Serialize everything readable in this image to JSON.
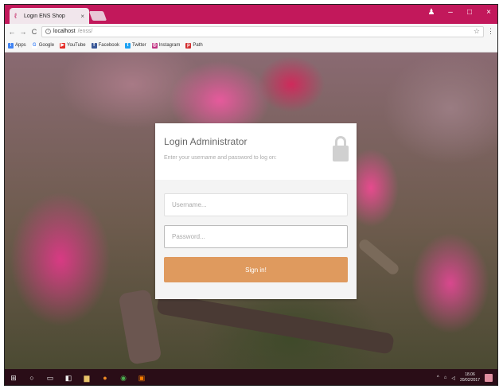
{
  "browser": {
    "tab_title": "Login ENS Shop",
    "tab_close": "×",
    "url_host": "localhost",
    "url_path": "/enss/",
    "window_controls": [
      "–",
      "□",
      "×"
    ],
    "nav_back": "←",
    "nav_forward": "→",
    "nav_reload": "C",
    "bookmarks": [
      {
        "label": "Apps",
        "icon": "apps-icon",
        "color": "#4285f4"
      },
      {
        "label": "Google",
        "icon": "google-icon",
        "color": "#4285f4"
      },
      {
        "label": "YouTube",
        "icon": "youtube-icon",
        "color": "#e52d27"
      },
      {
        "label": "Facebook",
        "icon": "facebook-icon",
        "color": "#3b5998"
      },
      {
        "label": "Twitter",
        "icon": "twitter-icon",
        "color": "#1da1f2"
      },
      {
        "label": "Instagram",
        "icon": "instagram-icon",
        "color": "#c13584"
      },
      {
        "label": "Path",
        "icon": "path-icon",
        "color": "#d32f2f"
      }
    ]
  },
  "login": {
    "title": "Login Administrator",
    "subtitle": "Enter your username and password to log on:",
    "username_placeholder": "Username...",
    "password_placeholder": "Password...",
    "signin_label": "Sign in!",
    "accent_color": "#df9a5e"
  },
  "taskbar": {
    "time": "18.06",
    "date": "20/02/2017"
  }
}
